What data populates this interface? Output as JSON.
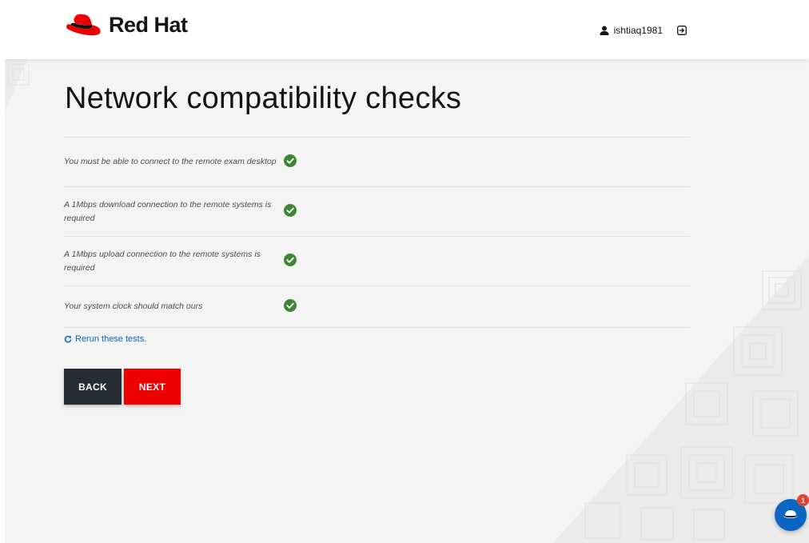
{
  "header": {
    "logo_text": "Red Hat",
    "username": "ishtiaq1981",
    "user_icon": "user-icon",
    "logout_icon": "logout-icon"
  },
  "page": {
    "title": "Network compatibility checks"
  },
  "checks": [
    {
      "label": "You must be able to connect to the remote exam desktop",
      "status": "passed"
    },
    {
      "label": "A 1Mbps download connection to the remote systems is required",
      "status": "passed"
    },
    {
      "label": "A 1Mbps upload connection to the remote systems is required",
      "status": "passed"
    },
    {
      "label": "Your system clock should match ours",
      "status": "passed"
    }
  ],
  "rerun": {
    "label": "Rerun these tests.",
    "icon": "refresh-icon"
  },
  "buttons": {
    "back_label": "BACK",
    "next_label": "NEXT"
  },
  "chat": {
    "badge_count": "1",
    "icon": "chat-icon"
  },
  "colors": {
    "brand_red": "#ee0000",
    "back_button": "#252c34",
    "success_green": "#3e8635",
    "link_blue": "#0066cc",
    "chat_blue": "#0a66c2",
    "badge_red": "#e8412c"
  }
}
